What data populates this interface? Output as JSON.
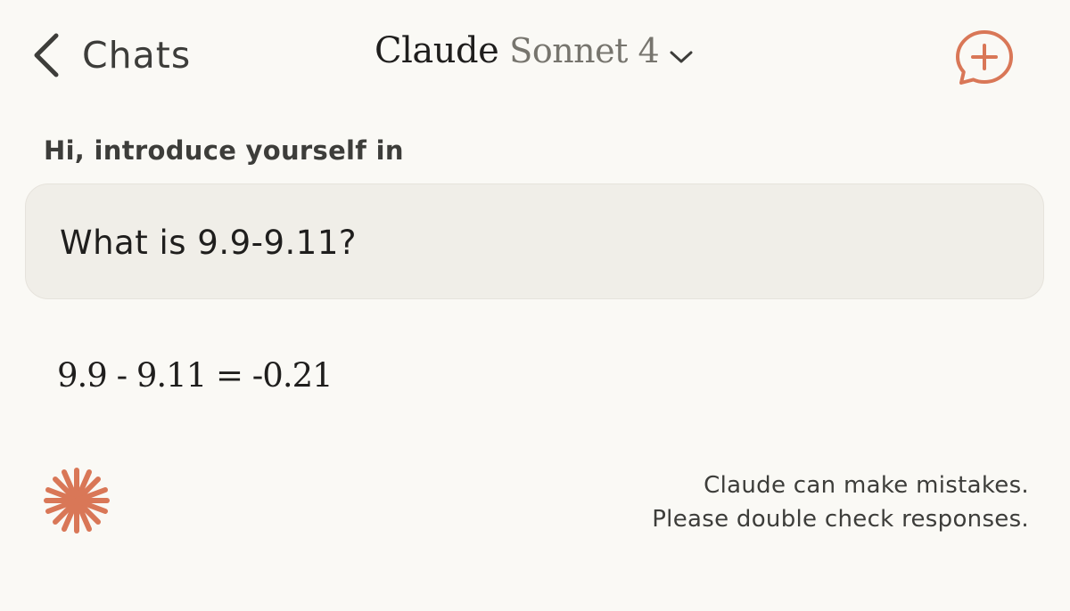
{
  "header": {
    "back_label": "Chats",
    "title": "Claude",
    "model": "Sonnet 4",
    "icons": {
      "back": "chevron-left-icon",
      "model_dropdown": "chevron-down-icon",
      "new_chat": "new-chat-bubble-plus-icon"
    }
  },
  "conversation": {
    "user_prefix": "Hi, introduce yourself in",
    "user_message": "What is 9.9-9.11?",
    "assistant_message": "9.9 - 9.11 = -0.21"
  },
  "footer": {
    "logo_icon": "claude-spark-icon",
    "disclaimer_line1": "Claude can make mistakes.",
    "disclaimer_line2": "Please double check responses."
  },
  "colors": {
    "background": "#faf9f5",
    "bubble": "#f0eee8",
    "accent": "#d97757",
    "text": "#1f1e1d",
    "muted": "#77756e"
  }
}
